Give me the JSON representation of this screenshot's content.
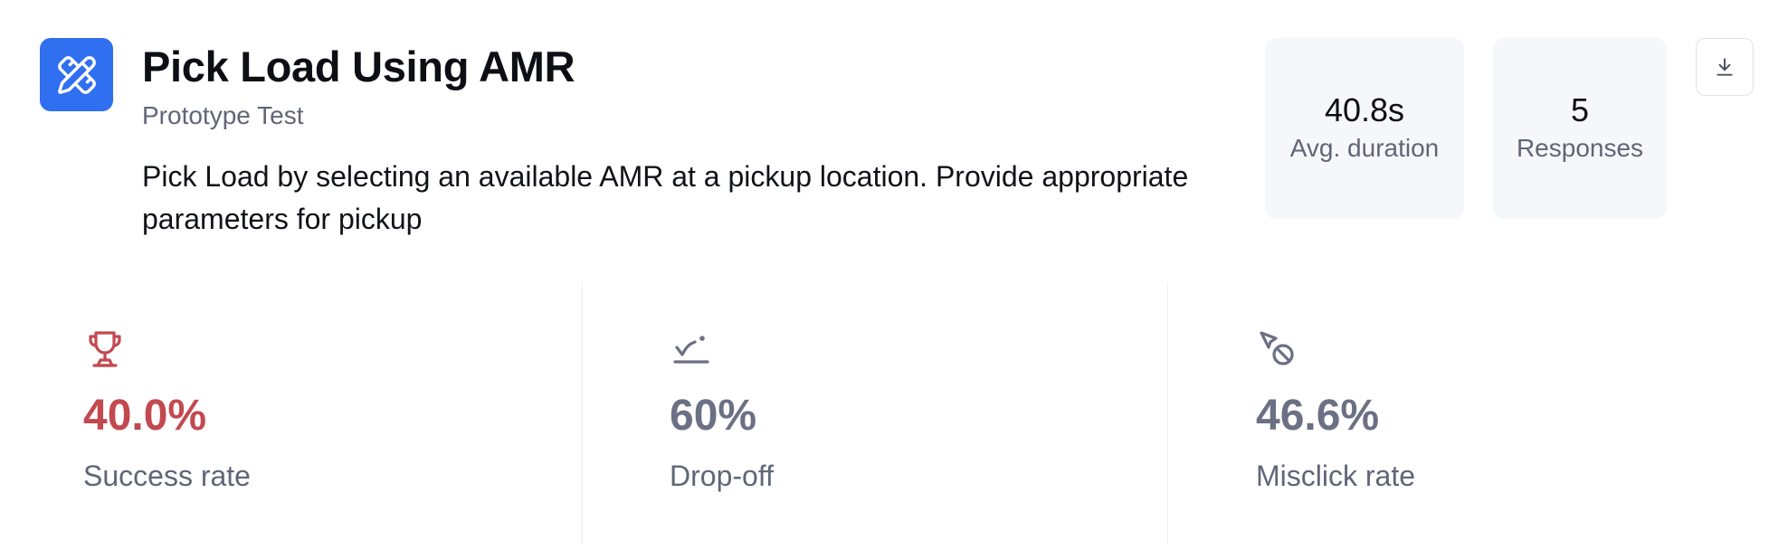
{
  "header": {
    "title": "Pick Load Using AMR",
    "subtitle": "Prototype Test",
    "description": "Pick Load by selecting an available AMR at a pickup location. Provide appropriate parameters for pickup",
    "app_icon": "pencil-ruler-icon"
  },
  "stats": {
    "duration": {
      "value": "40.8s",
      "label": "Avg. duration"
    },
    "responses": {
      "value": "5",
      "label": "Responses"
    }
  },
  "download_icon": "download-icon",
  "metrics": {
    "success": {
      "icon": "trophy-icon",
      "value": "40.0%",
      "label": "Success rate",
      "color": "#c2494f"
    },
    "dropoff": {
      "icon": "drop-off-icon",
      "value": "60%",
      "label": "Drop-off",
      "color": "#6b7085"
    },
    "misclick": {
      "icon": "misclick-icon",
      "value": "46.6%",
      "label": "Misclick rate",
      "color": "#6b7085"
    }
  },
  "colors": {
    "accent": "#2f6ff0",
    "card_bg": "#f6f7fa",
    "muted_text": "#5f6677"
  }
}
